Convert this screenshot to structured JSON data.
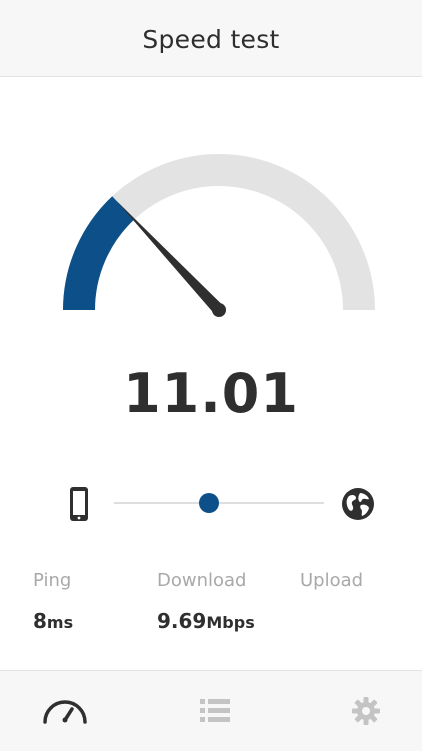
{
  "header": {
    "title": "Speed test"
  },
  "gauge": {
    "current_value": "11.01",
    "fill_fraction": 0.26,
    "fill_color": "#0d5089",
    "track_color": "#e3e3e3"
  },
  "progress": {
    "position_fraction": 0.45
  },
  "stats": {
    "ping": {
      "label": "Ping",
      "value": "8",
      "unit": "ms"
    },
    "download": {
      "label": "Download",
      "value": "9.69",
      "unit": "Mbps"
    },
    "upload": {
      "label": "Upload",
      "value": "",
      "unit": ""
    }
  },
  "tabs": [
    {
      "icon": "speedometer-icon",
      "active": true
    },
    {
      "icon": "list-icon",
      "active": false
    },
    {
      "icon": "gear-icon",
      "active": false
    }
  ],
  "colors": {
    "accent": "#0d5089",
    "text": "#2f2f2f",
    "muted": "#a9a9a9",
    "inactive_icon": "#c4c4c4"
  }
}
